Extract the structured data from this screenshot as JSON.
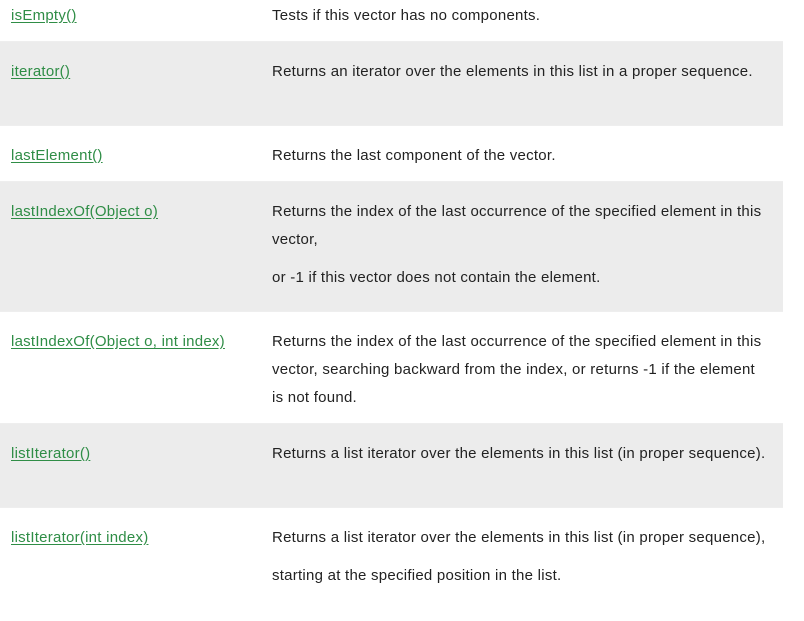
{
  "methods": [
    {
      "name": "isEmpty()",
      "description": [
        "Tests if this vector has no components."
      ]
    },
    {
      "name": "iterator()",
      "description": [
        "Returns an iterator over the elements in this list in a proper sequence."
      ]
    },
    {
      "name": "lastElement()",
      "description": [
        "Returns the last component of the vector."
      ]
    },
    {
      "name": "lastIndexOf(Object o)",
      "description": [
        "Returns the index of the last occurrence of the specified element in this vector,",
        "or -1 if this vector does not contain the element."
      ]
    },
    {
      "name": "lastIndexOf(Object o, int index)",
      "description": [
        "Returns the index of the last occurrence of the specified element in this vector, searching backward from the index, or returns -1 if the element is not found."
      ]
    },
    {
      "name": "listIterator()",
      "description": [
        "Returns a list iterator over the elements in this list (in proper sequence)."
      ]
    },
    {
      "name": "listIterator(int index)",
      "description": [
        "Returns a list iterator over the elements in this list (in proper sequence),",
        "starting at the specified position in the list."
      ]
    }
  ]
}
